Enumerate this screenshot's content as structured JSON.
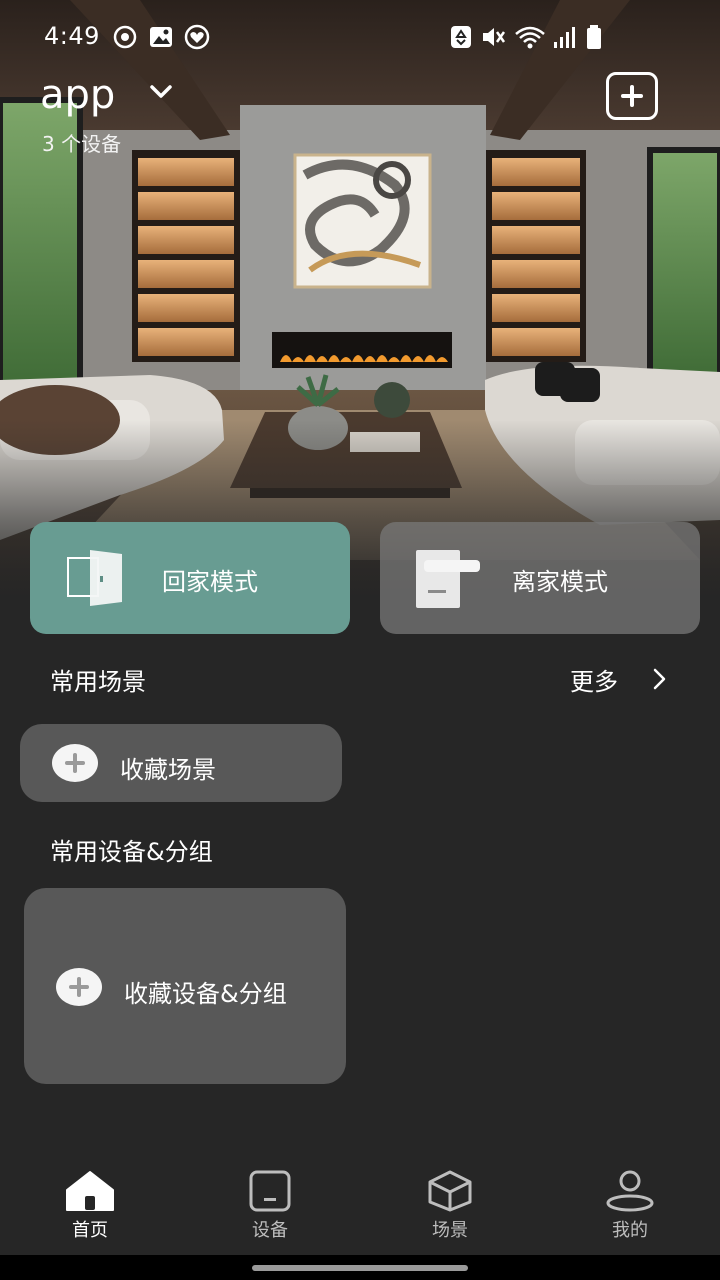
{
  "status_bar": {
    "time": "4:49",
    "left_icons": [
      "eye-icon",
      "image-icon",
      "heart-icon"
    ],
    "right_icons": [
      "recycle-icon",
      "mute-icon",
      "wifi-icon",
      "signal-icon",
      "battery-icon"
    ]
  },
  "header": {
    "home_name": "app",
    "device_count": "3 个设备"
  },
  "modes": {
    "home_label": "回家模式",
    "away_label": "离家模式",
    "home_color": "#689c92"
  },
  "scenes": {
    "title": "常用场景",
    "more_label": "更多",
    "favorite_label": "收藏场景"
  },
  "devices": {
    "title": "常用设备&分组",
    "favorite_label": "收藏设备&分组"
  },
  "nav": {
    "items": [
      {
        "label": "首页",
        "icon": "home-icon",
        "active": true
      },
      {
        "label": "设备",
        "icon": "device-icon",
        "active": false
      },
      {
        "label": "场景",
        "icon": "cube-icon",
        "active": false
      },
      {
        "label": "我的",
        "icon": "person-icon",
        "active": false
      }
    ]
  }
}
